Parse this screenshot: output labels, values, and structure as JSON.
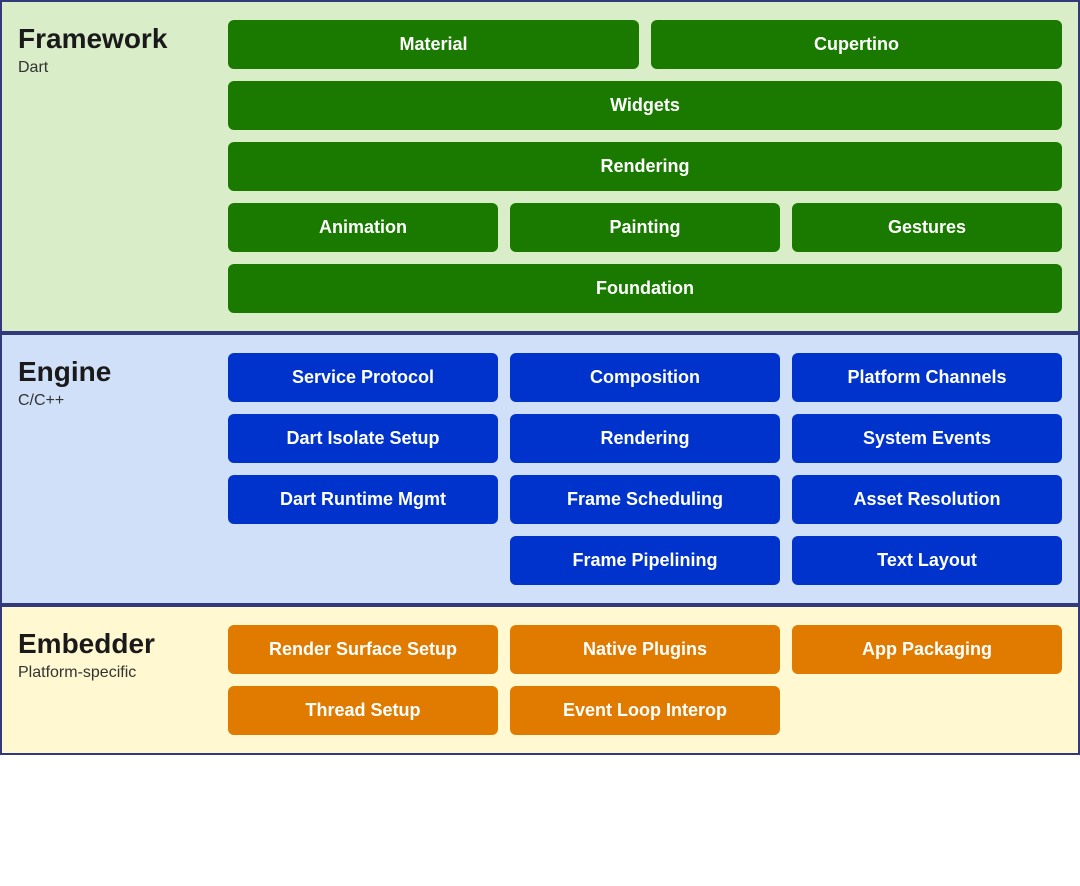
{
  "framework": {
    "title": "Framework",
    "subtitle": "Dart",
    "rows": [
      [
        {
          "label": "Material",
          "span": "half"
        },
        {
          "label": "Cupertino",
          "span": "half"
        }
      ],
      [
        {
          "label": "Widgets",
          "span": "full"
        }
      ],
      [
        {
          "label": "Rendering",
          "span": "full"
        }
      ],
      [
        {
          "label": "Animation",
          "span": "third"
        },
        {
          "label": "Painting",
          "span": "third"
        },
        {
          "label": "Gestures",
          "span": "third"
        }
      ],
      [
        {
          "label": "Foundation",
          "span": "full"
        }
      ]
    ]
  },
  "engine": {
    "title": "Engine",
    "subtitle": "C/C++",
    "rows": [
      [
        {
          "label": "Service Protocol",
          "span": "third"
        },
        {
          "label": "Composition",
          "span": "third"
        },
        {
          "label": "Platform Channels",
          "span": "third"
        }
      ],
      [
        {
          "label": "Dart Isolate Setup",
          "span": "third"
        },
        {
          "label": "Rendering",
          "span": "third"
        },
        {
          "label": "System Events",
          "span": "third"
        }
      ],
      [
        {
          "label": "Dart Runtime Mgmt",
          "span": "third"
        },
        {
          "label": "Frame Scheduling",
          "span": "third"
        },
        {
          "label": "Asset Resolution",
          "span": "third"
        }
      ],
      [
        {
          "label": "",
          "span": "spacer"
        },
        {
          "label": "Frame Pipelining",
          "span": "third"
        },
        {
          "label": "Text Layout",
          "span": "third"
        }
      ]
    ]
  },
  "embedder": {
    "title": "Embedder",
    "subtitle": "Platform-specific",
    "rows": [
      [
        {
          "label": "Render Surface Setup",
          "span": "third"
        },
        {
          "label": "Native Plugins",
          "span": "third"
        },
        {
          "label": "App Packaging",
          "span": "third"
        }
      ],
      [
        {
          "label": "Thread Setup",
          "span": "third"
        },
        {
          "label": "Event Loop Interop",
          "span": "third"
        },
        {
          "label": "",
          "span": "spacer"
        }
      ]
    ]
  }
}
